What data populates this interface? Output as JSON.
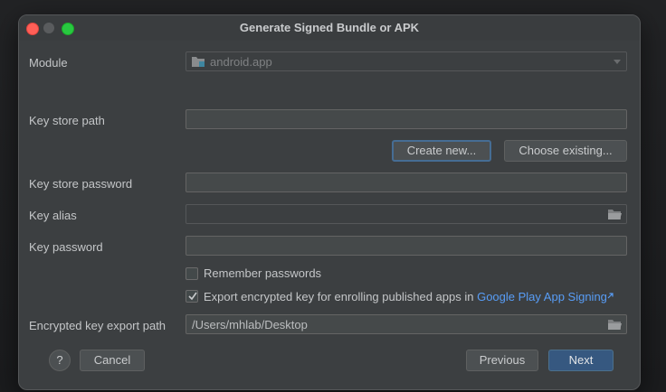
{
  "window": {
    "title": "Generate Signed Bundle or APK"
  },
  "module": {
    "label": "Module",
    "value": "android.app"
  },
  "keystore": {
    "path_label": "Key store path",
    "path_value": "",
    "create_new": "Create new...",
    "choose_existing": "Choose existing...",
    "password_label": "Key store password",
    "password_value": ""
  },
  "key": {
    "alias_label": "Key alias",
    "alias_value": "",
    "password_label": "Key password",
    "password_value": ""
  },
  "options": {
    "remember_label": "Remember passwords",
    "remember_checked": false,
    "export_label": "Export encrypted key for enrolling published apps in ",
    "export_link": "Google Play App Signing",
    "export_checked": true
  },
  "export_path": {
    "label": "Encrypted key export path",
    "value": "/Users/mhlab/Desktop"
  },
  "buttons": {
    "help": "?",
    "cancel": "Cancel",
    "previous": "Previous",
    "next": "Next"
  },
  "colors": {
    "accent": "#365880",
    "link": "#589df6",
    "background": "#3c3f41"
  }
}
